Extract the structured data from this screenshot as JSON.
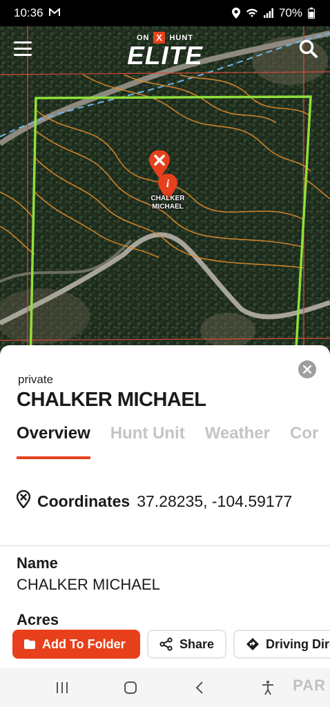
{
  "status_bar": {
    "time": "10:36",
    "battery": "70%"
  },
  "header": {
    "brand_prefix": "ON",
    "brand_mark": "X",
    "brand_suffix": "HUNT",
    "brand_name": "ELITE",
    "menu_icon": "hamburger-menu-icon",
    "search_icon": "search-icon"
  },
  "map": {
    "pin_label_line1": "CHALKER",
    "pin_label_line2": "MICHAEL",
    "boundary_color": "#8fe03a",
    "contour_color": "#e08a2a"
  },
  "panel": {
    "owner_type": "private",
    "owner_name": "CHALKER MICHAEL",
    "tabs": [
      {
        "label": "Overview",
        "active": true
      },
      {
        "label": "Hunt Unit",
        "active": false
      },
      {
        "label": "Weather",
        "active": false
      },
      {
        "label": "Cor",
        "active": false
      }
    ],
    "coordinates_label": "Coordinates",
    "coordinates_value": "37.28235, -104.59177",
    "fields": [
      {
        "label": "Name",
        "value": "CHALKER MICHAEL"
      },
      {
        "label": "Acres",
        "value": ""
      }
    ]
  },
  "actions": {
    "add_to_folder": "Add To Folder",
    "share": "Share",
    "driving_directions": "Driving Dire"
  },
  "watermark": "PAR",
  "colors": {
    "accent": "#e8401c",
    "tab_inactive": "#c4c4c4"
  }
}
